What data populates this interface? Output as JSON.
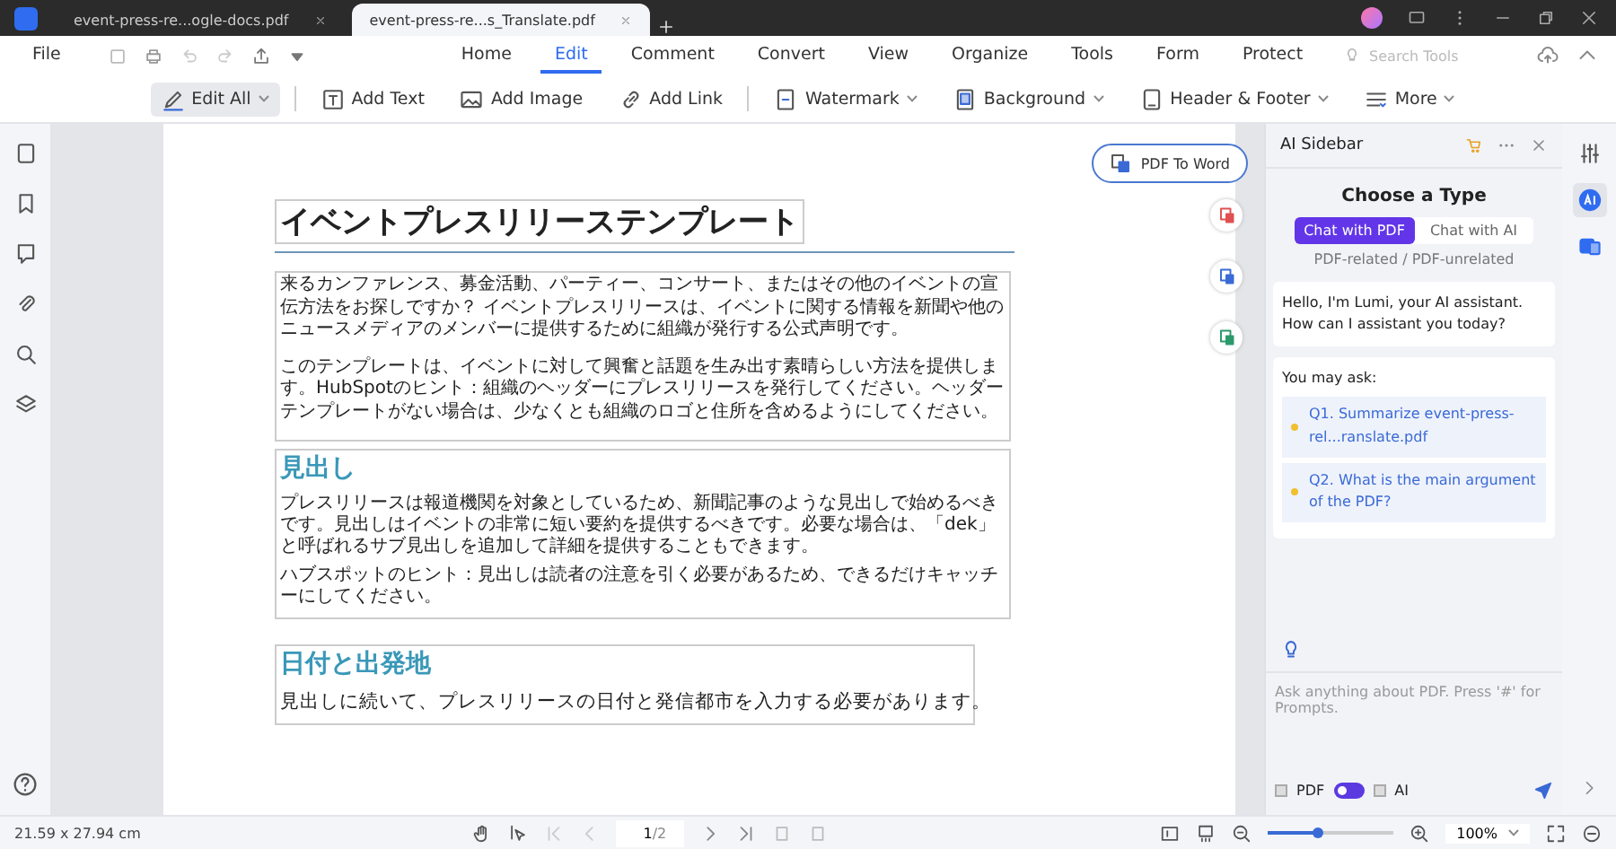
{
  "window": {
    "tabs": [
      {
        "label": "event-press-re...ogle-docs.pdf",
        "selected": false
      },
      {
        "label": "event-press-re...s_Translate.pdf",
        "selected": true
      }
    ]
  },
  "menu_bar": {
    "file": "File",
    "items": [
      {
        "label": "Home",
        "selected": false
      },
      {
        "label": "Edit",
        "selected": true
      },
      {
        "label": "Comment",
        "selected": false
      },
      {
        "label": "Convert",
        "selected": false
      },
      {
        "label": "View",
        "selected": false
      },
      {
        "label": "Organize",
        "selected": false
      },
      {
        "label": "Tools",
        "selected": false
      },
      {
        "label": "Form",
        "selected": false
      },
      {
        "label": "Protect",
        "selected": false
      }
    ],
    "search": {
      "placeholder": "Search Tools"
    }
  },
  "toolbar": [
    {
      "label": "Edit All",
      "kind": "edit",
      "dropdown": true,
      "selected": true
    },
    {
      "label": "Add Text",
      "kind": "text",
      "dropdown": false,
      "selected": false
    },
    {
      "label": "Add Image",
      "kind": "image",
      "dropdown": false,
      "selected": false
    },
    {
      "label": "Add Link",
      "kind": "link",
      "dropdown": false,
      "selected": false
    },
    {
      "label": "Watermark",
      "kind": "watermark",
      "dropdown": true,
      "selected": false
    },
    {
      "label": "Background",
      "kind": "background",
      "dropdown": true,
      "selected": false
    },
    {
      "label": "Header & Footer",
      "kind": "header",
      "dropdown": true,
      "selected": false
    },
    {
      "label": "More",
      "kind": "more",
      "dropdown": true,
      "selected": false
    }
  ],
  "document": {
    "title": "イベントプレスリリーステンプレート",
    "intro": [
      "来るカンファレンス、募金活動、パーティー、コンサート、またはその他のイベントの宣伝方法をお探しですか？ イベントプレスリリースは、イベントに関する情報を新聞や他のニュースメディアのメンバーに提供するために組織が発行する公式声明です。",
      "このテンプレートは、イベントに対して興奮と話題を生み出す素晴らしい方法を提供します。HubSpotのヒント：組織のヘッダーにプレスリリースを発行してください。ヘッダーテンプレートがない場合は、少なくとも組織のロゴと住所を含めるようにしてください。"
    ],
    "sections": [
      {
        "heading": "見出し",
        "body": "プレスリリースは報道機関を対象としているため、新聞記事のような見出しで始めるべきです。見出しはイベントの非常に短い要約を提供するべきです。必要な場合は、「dek」と呼ばれるサブ見出しを追加して詳細を提供することもできます。",
        "hint": "ハブスポットのヒント：見出しは読者の注意を引く必要があるため、できるだけキャッチーにしてください。"
      },
      {
        "heading": "日付と出発地",
        "body": "見出しに続いて、プレスリリースの日付と発信都市を入力する必要があります。"
      }
    ],
    "convert_button": "PDF To Word"
  },
  "ai_sidebar": {
    "title": "AI Sidebar",
    "choose_heading": "Choose a Type",
    "types": [
      {
        "label": "Chat with PDF",
        "selected": true
      },
      {
        "label": "Chat with AI",
        "selected": false
      }
    ],
    "type_hint": "PDF-related / PDF-unrelated",
    "greeting": "Hello, I'm Lumi, your AI assistant. How can I assistant you today?",
    "suggest_heading": "You may ask:",
    "questions": [
      "Q1. Summarize event-press-rel...ranslate.pdf",
      "Q2. What is the main argument of the PDF?"
    ],
    "input": {
      "placeholder": "Ask anything about PDF. Press '#' for Prompts."
    },
    "mode": {
      "left": "PDF",
      "left_checked": false,
      "right": "AI",
      "right_checked": false,
      "ai_on": false
    }
  },
  "status_bar": {
    "page_size": "21.59 x 27.94 cm",
    "page": "1",
    "page_total": "/2",
    "zoom": {
      "level": 0.4,
      "value": "100%"
    }
  }
}
